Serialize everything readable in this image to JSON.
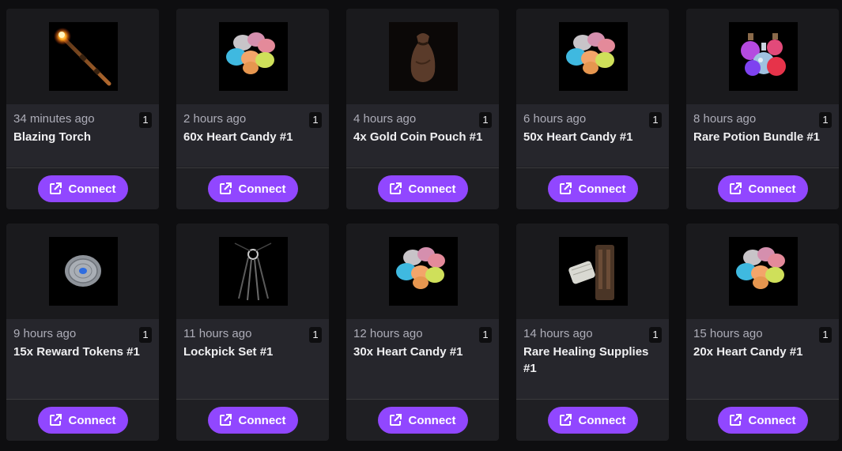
{
  "cards": [
    {
      "time": "34 minutes ago",
      "title": "Blazing Torch",
      "qty": "1",
      "button": "Connect",
      "icon": "torch-icon"
    },
    {
      "time": "2 hours ago",
      "title": "60x Heart Candy #1",
      "qty": "1",
      "button": "Connect",
      "icon": "heart-candy-icon"
    },
    {
      "time": "4 hours ago",
      "title": "4x Gold Coin Pouch #1",
      "qty": "1",
      "button": "Connect",
      "icon": "coin-pouch-icon"
    },
    {
      "time": "6 hours ago",
      "title": "50x Heart Candy #1",
      "qty": "1",
      "button": "Connect",
      "icon": "heart-candy-icon"
    },
    {
      "time": "8 hours ago",
      "title": "Rare Potion Bundle #1",
      "qty": "1",
      "button": "Connect",
      "icon": "potion-bundle-icon"
    },
    {
      "time": "9 hours ago",
      "title": "15x Reward Tokens #1",
      "qty": "1",
      "button": "Connect",
      "icon": "reward-token-icon"
    },
    {
      "time": "11 hours ago",
      "title": "Lockpick Set #1",
      "qty": "1",
      "button": "Connect",
      "icon": "lockpick-set-icon"
    },
    {
      "time": "12 hours ago",
      "title": "30x Heart Candy #1",
      "qty": "1",
      "button": "Connect",
      "icon": "heart-candy-icon"
    },
    {
      "time": "14 hours ago",
      "title": "Rare Healing Supplies #1",
      "qty": "1",
      "button": "Connect",
      "icon": "healing-supplies-icon"
    },
    {
      "time": "15 hours ago",
      "title": "20x Heart Candy #1",
      "qty": "1",
      "button": "Connect",
      "icon": "heart-candy-icon"
    }
  ],
  "colors": {
    "accent": "#9147ff",
    "background": "#0e0e10",
    "card": "#1f1f23"
  }
}
